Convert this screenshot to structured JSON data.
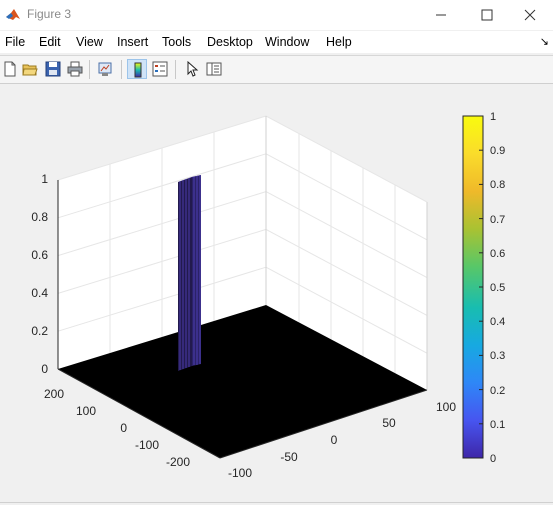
{
  "window": {
    "title": "Figure 3"
  },
  "menu": {
    "items": [
      "File",
      "Edit",
      "View",
      "Insert",
      "Tools",
      "Desktop",
      "Window",
      "Help"
    ],
    "overflow_icon": "dock-arrow-icon"
  },
  "toolbar": {
    "buttons": [
      {
        "name": "new-figure",
        "icon": "new-document-icon"
      },
      {
        "name": "open-file",
        "icon": "open-folder-icon"
      },
      {
        "name": "save",
        "icon": "floppy-disk-icon"
      },
      {
        "name": "print",
        "icon": "printer-icon"
      },
      {
        "name": "link-plot",
        "icon": "link-plot-icon"
      },
      {
        "name": "insert-colorbar",
        "icon": "colorbar-icon",
        "pressed": true
      },
      {
        "name": "insert-legend",
        "icon": "legend-icon"
      },
      {
        "name": "edit-plot",
        "icon": "pointer-arrow-icon"
      },
      {
        "name": "plot-tools",
        "icon": "property-editor-icon"
      }
    ]
  },
  "chart_data": {
    "type": "surface",
    "title": "",
    "xlabel": "",
    "ylabel": "",
    "zlabel": "",
    "x_ticks": [
      "-100",
      "-50",
      "0",
      "50",
      "100"
    ],
    "y_ticks": [
      "200",
      "100",
      "0",
      "-100",
      "-200"
    ],
    "z_ticks": [
      "0",
      "0.2",
      "0.4",
      "0.6",
      "0.8",
      "1"
    ],
    "xlim": [
      -120,
      120
    ],
    "ylim": [
      -240,
      240
    ],
    "zlim": [
      0,
      1
    ],
    "grid": true,
    "colormap": "parula",
    "surface": {
      "background_value": 0,
      "pulse": {
        "x_range": [
          -120,
          -108
        ],
        "y_range": [
          -20,
          20
        ],
        "z": 1
      }
    },
    "colorbar": {
      "ticks": [
        "0",
        "0.1",
        "0.2",
        "0.3",
        "0.4",
        "0.5",
        "0.6",
        "0.7",
        "0.8",
        "0.9",
        "1"
      ],
      "limits": [
        0,
        1
      ],
      "placement": "right",
      "colors": [
        "#3e26a8",
        "#4755f0",
        "#2e87f7",
        "#17a9e1",
        "#18bdb0",
        "#58c768",
        "#a9c232",
        "#efb92a",
        "#fadc2b",
        "#f9fb0e"
      ]
    }
  }
}
